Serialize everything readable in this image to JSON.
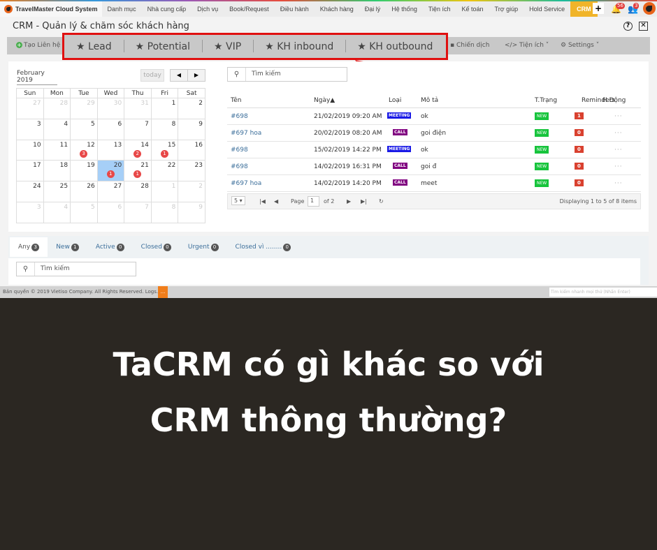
{
  "nav": {
    "brand": "TravelMaster Cloud System",
    "items": [
      "Danh mục",
      "Nhà cung cấp",
      "Dịch vụ",
      "Book/Request",
      "Điều hành",
      "Khách hàng",
      "Đại lý",
      "Hệ thống",
      "Tiện ích",
      "Kế toán",
      "Trợ giúp",
      "Hold Service"
    ],
    "active": "CRM",
    "plus": "+",
    "notifications": "56",
    "users": "3"
  },
  "page": {
    "title": "CRM - Quản lý & chăm sóc khách hàng",
    "help": "?",
    "close": "✕"
  },
  "toolbar": {
    "add_contact": "Tạo Liên hệ",
    "highlighted": [
      "Lead",
      "Potential",
      "VIP",
      "KH inbound",
      "KH outbound"
    ],
    "campaign": "Chiến dịch",
    "utilities": "</> Tiện ích ˅",
    "settings": "Settings ˅"
  },
  "calendar": {
    "month": "February 2019",
    "today": "today",
    "prev": "◀",
    "next": "▶",
    "weekdays": [
      "Sun",
      "Mon",
      "Tue",
      "Wed",
      "Thu",
      "Fri",
      "Sat"
    ],
    "weeks": [
      [
        [
          "27",
          1
        ],
        [
          "28",
          1
        ],
        [
          "29",
          1
        ],
        [
          "30",
          1
        ],
        [
          "31",
          1
        ],
        [
          "1",
          0
        ],
        [
          "2",
          0
        ]
      ],
      [
        [
          "3",
          0
        ],
        [
          "4",
          0
        ],
        [
          "5",
          0
        ],
        [
          "6",
          0
        ],
        [
          "7",
          0
        ],
        [
          "8",
          0
        ],
        [
          "9",
          0
        ]
      ],
      [
        [
          "10",
          0
        ],
        [
          "11",
          0
        ],
        [
          "12",
          0,
          "3"
        ],
        [
          "13",
          0
        ],
        [
          "14",
          0,
          "2"
        ],
        [
          "15",
          0,
          "1"
        ],
        [
          "16",
          0
        ]
      ],
      [
        [
          "17",
          0
        ],
        [
          "18",
          0
        ],
        [
          "19",
          0
        ],
        [
          "20",
          0,
          "1",
          1
        ],
        [
          "21",
          0,
          "1"
        ],
        [
          "22",
          0
        ],
        [
          "23",
          0
        ]
      ],
      [
        [
          "24",
          0
        ],
        [
          "25",
          0
        ],
        [
          "26",
          0
        ],
        [
          "27",
          0
        ],
        [
          "28",
          0
        ],
        [
          "1",
          1
        ],
        [
          "2",
          1
        ]
      ],
      [
        [
          "3",
          1
        ],
        [
          "4",
          1
        ],
        [
          "5",
          1
        ],
        [
          "6",
          1
        ],
        [
          "7",
          1
        ],
        [
          "8",
          1
        ],
        [
          "9",
          1
        ]
      ]
    ]
  },
  "search": {
    "placeholder": "Tìm kiếm"
  },
  "table": {
    "columns": [
      "Tên",
      "Ngày▲",
      "Loại",
      "Mô tả",
      "T.Trạng",
      "Reminders",
      "H.Động"
    ],
    "rows": [
      {
        "name": "#698",
        "date": "21/02/2019 09:20 AM",
        "type": "MEETING",
        "desc": "ok",
        "status": "NEW",
        "reminders": "1",
        "action": "···"
      },
      {
        "name": "#697 hoa",
        "date": "20/02/2019 08:20 AM",
        "type": "CALL",
        "desc": "goi điện",
        "status": "NEW",
        "reminders": "0",
        "action": "···"
      },
      {
        "name": "#698",
        "date": "15/02/2019 14:22 PM",
        "type": "MEETING",
        "desc": "ok",
        "status": "NEW",
        "reminders": "0",
        "action": "···"
      },
      {
        "name": "#698",
        "date": "14/02/2019 16:31 PM",
        "type": "CALL",
        "desc": "goi đ",
        "status": "NEW",
        "reminders": "0",
        "action": "···"
      },
      {
        "name": "#697 hoa",
        "date": "14/02/2019 14:20 PM",
        "type": "CALL",
        "desc": "meet",
        "status": "NEW",
        "reminders": "0",
        "action": "···"
      }
    ]
  },
  "pager": {
    "size": "5 ▾",
    "page_label": "Page",
    "page": "1",
    "of": "of 2",
    "summary": "Displaying 1 to 5 of 8 items"
  },
  "tabs": [
    {
      "label": "Any",
      "count": "3"
    },
    {
      "label": "New",
      "count": "1"
    },
    {
      "label": "Active",
      "count": "0"
    },
    {
      "label": "Closed",
      "count": "0"
    },
    {
      "label": "Urgent",
      "count": "0"
    },
    {
      "label": "Closed vì ........",
      "count": "0"
    }
  ],
  "footer": {
    "copyright": "Bản quyền © 2019 Vietiso Company. All Rights Reserved. Logs.",
    "quick_search": "Tìm kiếm nhanh mọi thứ (Nhấn Enter)",
    "btn": "..."
  },
  "headline": [
    "TaCRM có gì khác so với",
    "CRM thông thường?"
  ]
}
